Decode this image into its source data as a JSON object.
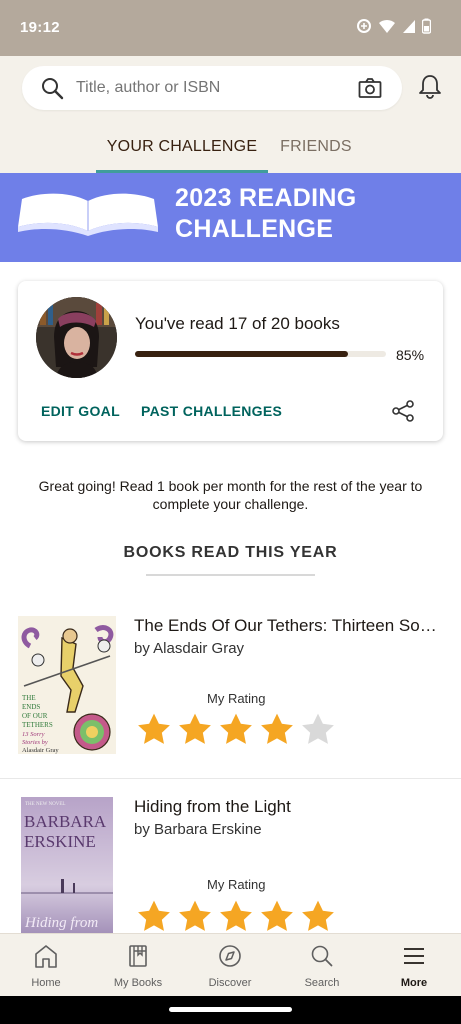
{
  "status_bar": {
    "time": "19:12"
  },
  "search": {
    "placeholder": "Title, author or ISBN"
  },
  "tabs": [
    {
      "label": "YOUR CHALLENGE",
      "active": true
    },
    {
      "label": "FRIENDS",
      "active": false
    }
  ],
  "banner": {
    "title_line1": "2023 READING",
    "title_line2": "CHALLENGE"
  },
  "challenge": {
    "progress_text": "You've read 17 of 20 books",
    "books_read": 17,
    "goal": 20,
    "progress_fraction": 0.85,
    "progress_percent": "85%",
    "edit_goal_label": "EDIT GOAL",
    "past_challenges_label": "PAST CHALLENGES"
  },
  "encouragement": "Great going! Read 1 book per month for the rest of the year to complete your challenge.",
  "section_title": "BOOKS READ THIS YEAR",
  "books": [
    {
      "title": "The Ends Of Our Tethers: Thirteen Sorry Stories",
      "author": "by Alasdair Gray",
      "rating_label": "My Rating",
      "rating": 4,
      "cover_text": "THE ENDS OF OUR TETHERS 13 Sorry Stories by Alasdair Gray"
    },
    {
      "title": "Hiding from the Light",
      "author": "by Barbara Erskine",
      "rating_label": "My Rating",
      "rating": 5,
      "cover_text": "BARBARA ERSKINE Hiding from the Light"
    }
  ],
  "bottom_nav": [
    {
      "label": "Home",
      "icon": "home-icon"
    },
    {
      "label": "My Books",
      "icon": "my-books-icon"
    },
    {
      "label": "Discover",
      "icon": "compass-icon"
    },
    {
      "label": "Search",
      "icon": "search-icon"
    },
    {
      "label": "More",
      "icon": "menu-icon",
      "active": true
    }
  ],
  "colors": {
    "status_bar": "#b4a99c",
    "header_bg": "#f4f1ea",
    "banner_bg": "#6f7fe8",
    "accent_teal": "#409d9b",
    "link_green": "#00635d",
    "progress_fill": "#382110",
    "star_filled": "#f5a623",
    "star_empty": "#d9d9d9"
  }
}
